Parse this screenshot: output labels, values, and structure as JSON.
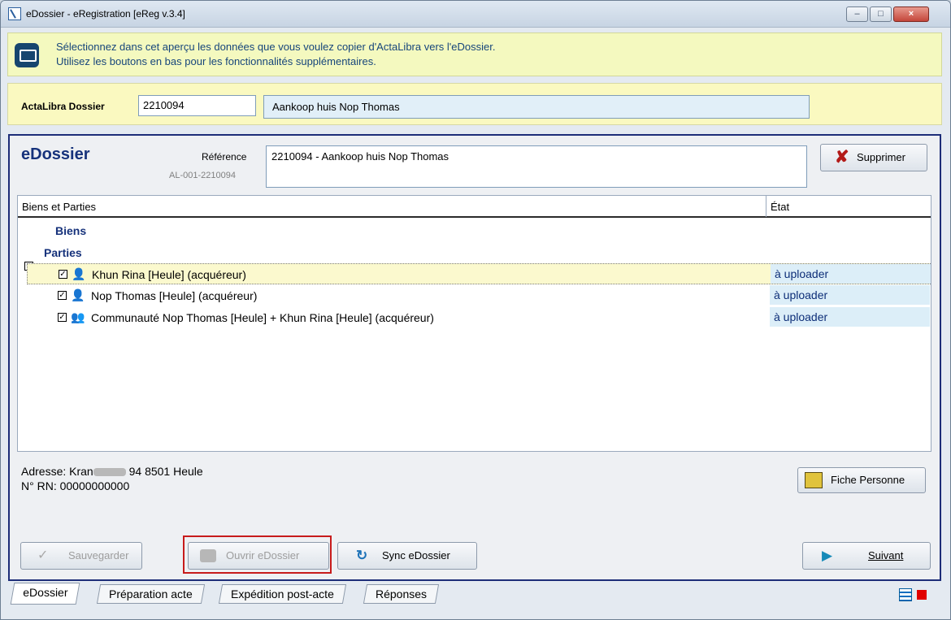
{
  "window": {
    "title": "eDossier - eRegistration [eReg v.3.4]",
    "min_label": "–",
    "max_label": "□",
    "close_label": "×"
  },
  "info": {
    "line1": "Sélectionnez dans cet aperçu les données que vous voulez copier d'ActaLibra vers l'eDossier.",
    "line2": "Utilisez les boutons en bas pour les fonctionnalités supplémentaires."
  },
  "actalibra": {
    "label": "ActaLibra Dossier",
    "number": "2210094",
    "title": "Aankoop huis Nop Thomas",
    "folder_icon": "🗁"
  },
  "edossier": {
    "title": "eDossier",
    "ref_label": "Référence",
    "ref_code": "AL-001-2210094",
    "ref_value": "2210094 - Aankoop huis Nop Thomas",
    "delete_label": "Supprimer",
    "delete_icon": "✘"
  },
  "tree": {
    "col_left": "Biens et Parties",
    "col_right": "État",
    "node_biens": "Biens",
    "node_parties": "Parties",
    "expander": "−",
    "rows": [
      {
        "label": "Khun Rina [Heule] (acquéreur)",
        "state": "à uploader",
        "icon": "👤"
      },
      {
        "label": "Nop Thomas [Heule] (acquéreur)",
        "state": "à uploader",
        "icon": "👤"
      },
      {
        "label": "Communauté Nop Thomas [Heule] + Khun Rina [Heule] (acquéreur)",
        "state": "à uploader",
        "icon": "👥"
      }
    ],
    "check": "✓"
  },
  "details": {
    "address_prefix": "Adresse: Kran",
    "address_suffix": " 94  8501 Heule",
    "rn": "N° RN: 00000000000",
    "fiche_label": "Fiche Personne"
  },
  "buttons": {
    "save": "Sauvegarder",
    "open": "Ouvrir eDossier",
    "sync": "Sync eDossier",
    "next": "Suivant",
    "save_icon": "✓",
    "sync_icon": "↻",
    "next_icon": "▶"
  },
  "tabs": [
    "eDossier",
    "Préparation acte",
    "Expédition post-acte",
    "Réponses"
  ]
}
